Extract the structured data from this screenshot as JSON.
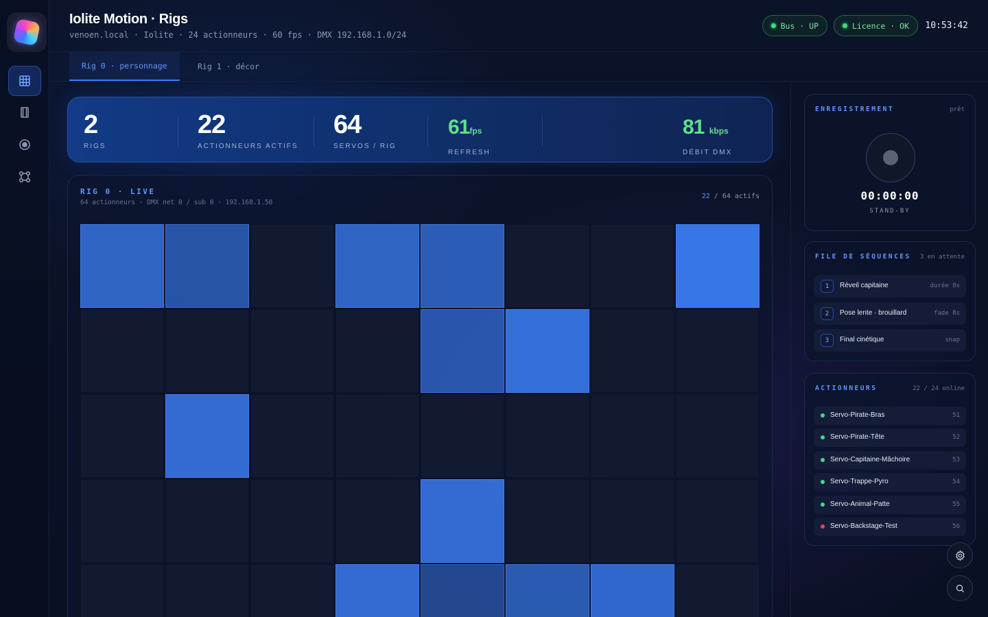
{
  "header": {
    "title": "Iolite Motion · Rigs",
    "subtitle": "venoen.local · Iolite · 24 actionneurs · 60 fps · DMX 192.168.1.0/24",
    "bus_pill": "Bus · UP",
    "licence_pill": "Licence · OK",
    "clock": "10:53:42"
  },
  "rail": {
    "icons": [
      "grid-icon",
      "film-icon",
      "record-icon",
      "nodes-icon"
    ]
  },
  "tabs": [
    {
      "label": "Rig 0 · personnage",
      "active": true
    },
    {
      "label": "Rig 1 · décor",
      "active": false
    }
  ],
  "stats": {
    "rigs": {
      "value": "2",
      "label": "RIGS"
    },
    "actuators": {
      "value": "22",
      "label": "ACTIONNEURS ACTIFS"
    },
    "servos": {
      "value": "64",
      "label": "SERVOS / RIG"
    },
    "refresh": {
      "value": "61",
      "unit": "fps",
      "label": "REFRESH"
    },
    "dmx": {
      "value": "81",
      "unit": "kbps",
      "label": "DÉBIT DMX"
    }
  },
  "rig": {
    "title": "RIG 0 · LIVE",
    "subtitle": "64 actionneurs · DMX net 0 / sub 0 · 192.168.1.50",
    "count_active": "22",
    "count_rest": " / 64 actifs",
    "grid": {
      "columns": 8,
      "cells": [
        [
          0.75,
          0.5,
          0,
          0.75,
          0.65,
          0,
          0,
          1.0
        ],
        [
          0,
          0,
          0,
          0,
          0.55,
          0.9,
          0,
          0
        ],
        [
          0,
          0.85,
          0,
          0,
          0,
          0,
          0,
          0
        ],
        [
          0,
          0,
          0,
          0,
          0.85,
          0,
          0,
          0
        ],
        [
          0,
          0,
          0,
          0.85,
          0.35,
          0.6,
          0.8,
          0
        ]
      ]
    }
  },
  "recording": {
    "title": "ENREGISTREMENT",
    "status": "prêt",
    "time": "00:00:00",
    "state": "STAND-BY"
  },
  "queue": {
    "title": "FILE DE SÉQUENCES",
    "meta": "3 en attente",
    "items": [
      {
        "num": "1",
        "name": "Réveil capitaine",
        "meta": "durée 8s"
      },
      {
        "num": "2",
        "name": "Pose lente · brouillard",
        "meta": "fade 8s"
      },
      {
        "num": "3",
        "name": "Final cinétique",
        "meta": "snap"
      }
    ]
  },
  "actuators": {
    "title": "ACTIONNEURS",
    "meta": "22 / 24 online",
    "items": [
      {
        "name": "Servo-Pirate-Bras",
        "id": "51",
        "status": "online"
      },
      {
        "name": "Servo-Pirate-Tête",
        "id": "52",
        "status": "online"
      },
      {
        "name": "Servo-Capitaine-Mâchoire",
        "id": "53",
        "status": "online"
      },
      {
        "name": "Servo-Trappe-Pyro",
        "id": "54",
        "status": "online"
      },
      {
        "name": "Servo-Animal-Patte",
        "id": "55",
        "status": "online"
      },
      {
        "name": "Servo-Backstage-Test",
        "id": "56",
        "status": "offline"
      }
    ]
  },
  "colors": {
    "accent": "#3d7dff",
    "online": "#3be07a",
    "offline": "#e04a5a",
    "cell_on": "#3574e0"
  }
}
